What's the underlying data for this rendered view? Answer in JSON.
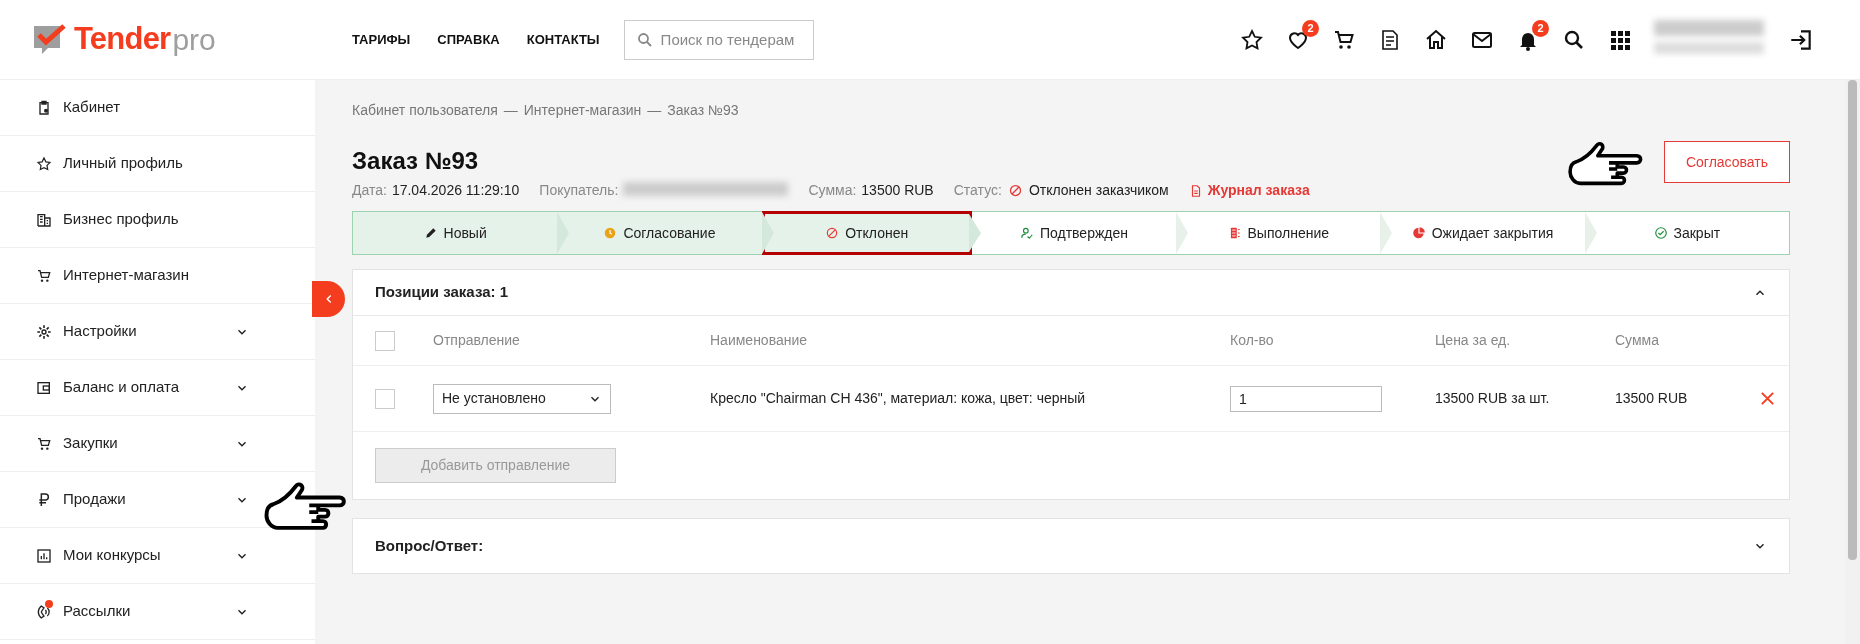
{
  "header": {
    "logo": {
      "brand": "Tender",
      "suffix": "pro"
    },
    "nav": [
      "ТАРИФЫ",
      "СПРАВКА",
      "КОНТАКТЫ"
    ],
    "search": {
      "placeholder": "Поиск по тендерам"
    },
    "icons": [
      {
        "kind": "star"
      },
      {
        "kind": "heart",
        "badge": "2"
      },
      {
        "kind": "cart"
      },
      {
        "kind": "document"
      },
      {
        "kind": "home"
      },
      {
        "kind": "mail"
      },
      {
        "kind": "bell",
        "badge": "2"
      },
      {
        "kind": "search"
      },
      {
        "kind": "grid"
      }
    ]
  },
  "sidebar": {
    "items": [
      {
        "kind": "clipboard",
        "label": "Кабинет",
        "expandable": false,
        "dot": false
      },
      {
        "kind": "star",
        "label": "Личный профиль",
        "expandable": false,
        "dot": false
      },
      {
        "kind": "building",
        "label": "Бизнес профиль",
        "expandable": false,
        "dot": false
      },
      {
        "kind": "cart",
        "label": "Интернет-магазин",
        "expandable": false,
        "dot": false
      },
      {
        "kind": "gear",
        "label": "Настройки",
        "expandable": true,
        "dot": false
      },
      {
        "kind": "wallet",
        "label": "Баланс и оплата",
        "expandable": true,
        "dot": false
      },
      {
        "kind": "cart",
        "label": "Закупки",
        "expandable": true,
        "dot": false
      },
      {
        "kind": "ruble",
        "label": "Продажи",
        "expandable": true,
        "dot": false
      },
      {
        "kind": "chart",
        "label": "Мои конкурсы",
        "expandable": true,
        "dot": false
      },
      {
        "kind": "phone",
        "label": "Рассылки",
        "expandable": true,
        "dot": true
      }
    ]
  },
  "breadcrumb": [
    {
      "label": "Кабинет пользователя",
      "separator": "—"
    },
    {
      "label": "Интернет-магазин",
      "separator": "—"
    },
    {
      "label": "Заказ №93"
    }
  ],
  "order": {
    "title": "Заказ №93",
    "meta": [
      {
        "label": "Дата:",
        "value": "17.04.2026 11:29:10"
      },
      {
        "label": "Покупатель:"
      },
      {
        "label": "Сумма:",
        "value": "13500 RUB"
      }
    ],
    "status_label": "Статус:",
    "status": "Отклонен заказчиком",
    "log_link": "Журнал заказа",
    "approve_button": "Согласовать"
  },
  "steps": [
    {
      "kind": "pencil",
      "label": "Новый",
      "reached": true,
      "highlighted": false
    },
    {
      "kind": "clock",
      "label": "Согласование",
      "reached": true,
      "highlighted": false
    },
    {
      "kind": "ban",
      "label": "Отклонен",
      "reached": true,
      "highlighted": true
    },
    {
      "kind": "user-check",
      "label": "Подтвержден",
      "reached": false,
      "highlighted": false
    },
    {
      "kind": "server",
      "label": "Выполнение",
      "reached": false,
      "highlighted": false
    },
    {
      "kind": "pie",
      "label": "Ожидает закрытия",
      "reached": false,
      "highlighted": false
    },
    {
      "kind": "check",
      "label": "Закрыт",
      "reached": false,
      "highlighted": false
    }
  ],
  "positions": {
    "title": "Позиции заказа: 1",
    "expanded": true,
    "columns": [
      "Отправление",
      "Наименование",
      "Кол-во",
      "Цена за ед.",
      "Сумма"
    ],
    "select_all": {
      "checked": false
    },
    "rows": [
      {
        "checked": false,
        "shipment": "Не установлено",
        "name": "Кресло \"Chairman CH 436\", материал: кожа, цвет: черный",
        "quantity": "1",
        "price": "13500 RUB за шт.",
        "sum": "13500 RUB"
      }
    ],
    "add_button": "Добавить отправление"
  },
  "qa": {
    "title": "Вопрос/Ответ:",
    "expanded": false
  }
}
